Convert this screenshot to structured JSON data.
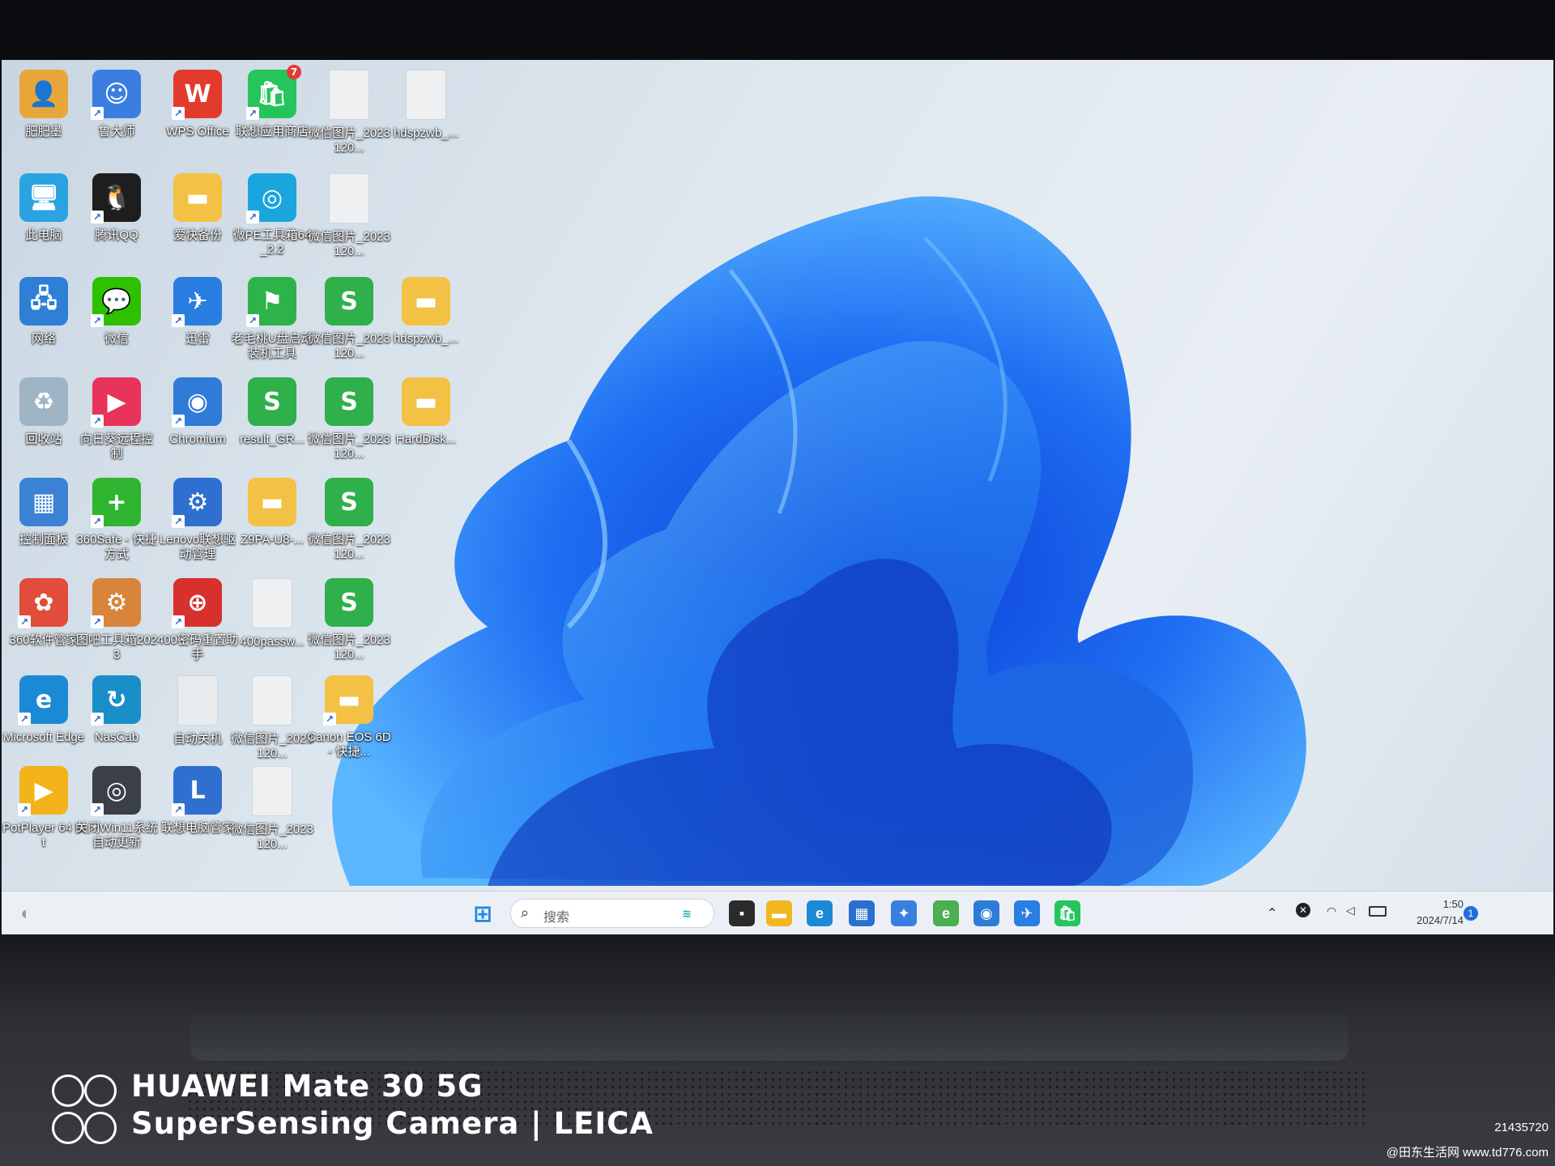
{
  "desktop_icons": [
    {
      "label": "肥肥墨",
      "color": "#e8a63a",
      "glyph": "👤",
      "shortcut": false
    },
    {
      "label": "此电脑",
      "color": "#2aa3e0",
      "glyph": "🖥",
      "shortcut": false
    },
    {
      "label": "网络",
      "color": "#2f7fd6",
      "glyph": "🖧",
      "shortcut": false
    },
    {
      "label": "回收站",
      "color": "#9fb4c4",
      "glyph": "♻",
      "shortcut": false
    },
    {
      "label": "控制面板",
      "color": "#3b82d4",
      "glyph": "▦",
      "shortcut": false
    },
    {
      "label": "360软件管家",
      "color": "#e14c3b",
      "glyph": "✿",
      "shortcut": true
    },
    {
      "label": "Microsoft Edge",
      "color": "#1b8ad6",
      "glyph": "e",
      "shortcut": true
    },
    {
      "label": "PotPlayer 64 bit",
      "color": "#f2b31b",
      "glyph": "▶",
      "shortcut": true
    },
    {
      "label": "鲁大师",
      "color": "#3a7fe0",
      "glyph": "☺",
      "shortcut": true
    },
    {
      "label": "腾讯QQ",
      "color": "#1e1e1e",
      "glyph": "🐧",
      "shortcut": true
    },
    {
      "label": "微信",
      "color": "#2dc100",
      "glyph": "💬",
      "shortcut": true
    },
    {
      "label": "向日葵远程控制",
      "color": "#e8345a",
      "glyph": "▶",
      "shortcut": true
    },
    {
      "label": "360Safe - 快捷方式",
      "color": "#2fb52f",
      "glyph": "+",
      "shortcut": true
    },
    {
      "label": "图吧工具箱2023",
      "color": "#d8843b",
      "glyph": "⚙",
      "shortcut": true
    },
    {
      "label": "NasCab",
      "color": "#1a8ec8",
      "glyph": "↻",
      "shortcut": true
    },
    {
      "label": "关闭Win11系统自动更新",
      "color": "#3a3f48",
      "glyph": "◎",
      "shortcut": true
    },
    {
      "label": "WPS Office",
      "color": "#e23b2e",
      "glyph": "W",
      "shortcut": true
    },
    {
      "label": "爱快备份",
      "color": "#f3c244",
      "glyph": "▬",
      "shortcut": false
    },
    {
      "label": "迅雷",
      "color": "#2a7de1",
      "glyph": "✈",
      "shortcut": true
    },
    {
      "label": "Chromium",
      "color": "#2e7bd8",
      "glyph": "◉",
      "shortcut": true
    },
    {
      "label": "Lenovo联想驱动管理",
      "color": "#2f6fd0",
      "glyph": "⚙",
      "shortcut": true
    },
    {
      "label": "400密码重置助手",
      "color": "#d8302c",
      "glyph": "⊕",
      "shortcut": true
    },
    {
      "label": "自动关机",
      "color": "#e9ecef",
      "glyph": "",
      "shortcut": false
    },
    {
      "label": "联想电脑管家",
      "color": "#2f6fd0",
      "glyph": "L",
      "shortcut": true
    },
    {
      "label": "联想应用商店",
      "color": "#25c45c",
      "glyph": "🛍",
      "shortcut": true
    },
    {
      "label": "微PE工具箱64_2.2",
      "color": "#1aa6dc",
      "glyph": "◎",
      "shortcut": true
    },
    {
      "label": "老毛桃U盘启动装机工具",
      "color": "#2db34a",
      "glyph": "⚑",
      "shortcut": true
    },
    {
      "label": "result_GR...",
      "color": "#2fb04a",
      "glyph": "S",
      "shortcut": false
    },
    {
      "label": "Z9PA-U8-...",
      "color": "#f3c244",
      "glyph": "▬",
      "shortcut": false
    },
    {
      "label": "400passw...",
      "color": "#eef0f2",
      "glyph": "",
      "shortcut": false
    },
    {
      "label": "微信图片_2023120...",
      "color": "#eef0f2",
      "glyph": "",
      "shortcut": false
    },
    {
      "label": "微信图片_2023120...",
      "color": "#eef0f2",
      "glyph": "",
      "shortcut": false
    },
    {
      "label": "微信图片_2023120...",
      "color": "#eef0f2",
      "glyph": "",
      "shortcut": false
    },
    {
      "label": "微信图片_2023120...",
      "color": "#eef0f2",
      "glyph": "",
      "shortcut": false
    },
    {
      "label": "微信图片_2023120...",
      "color": "#2fb04a",
      "glyph": "S",
      "shortcut": false
    },
    {
      "label": "微信图片_2023120...",
      "color": "#2fb04a",
      "glyph": "S",
      "shortcut": false
    },
    {
      "label": "微信图片_2023120...",
      "color": "#2fb04a",
      "glyph": "S",
      "shortcut": false
    },
    {
      "label": "微信图片_2023120...",
      "color": "#2fb04a",
      "glyph": "S",
      "shortcut": false
    },
    {
      "label": "Canon EOS 6D - 快捷...",
      "color": "#f3c244",
      "glyph": "▬",
      "shortcut": true
    },
    {
      "label": "hdspzwb_...",
      "color": "#eef0f2",
      "glyph": "",
      "shortcut": false
    },
    {
      "label": "hdspzwb_...",
      "color": "#f3c244",
      "glyph": "▬",
      "shortcut": false
    },
    {
      "label": "HardDisk...",
      "color": "#f3c244",
      "glyph": "▬",
      "shortcut": false
    }
  ],
  "store_badge": "7",
  "taskbar": {
    "search_placeholder": "搜索",
    "pinned": [
      {
        "name": "windows-start-icon",
        "color": "#1e88e5",
        "glyph": "⊞"
      },
      {
        "name": "task-view-icon",
        "color": "#2b2b2b",
        "glyph": "▪"
      },
      {
        "name": "file-explorer-icon",
        "color": "#f2b720",
        "glyph": "▬"
      },
      {
        "name": "edge-icon",
        "color": "#1b8ad6",
        "glyph": "e"
      },
      {
        "name": "store-icon",
        "color": "#2a6fd0",
        "glyph": "▦"
      },
      {
        "name": "app-icon",
        "color": "#3a7fe0",
        "glyph": "✦"
      },
      {
        "name": "ie-icon",
        "color": "#4caf50",
        "glyph": "e"
      },
      {
        "name": "chromium-icon",
        "color": "#2e7bd8",
        "glyph": "◉"
      },
      {
        "name": "thunder-icon",
        "color": "#2a7de1",
        "glyph": "✈"
      },
      {
        "name": "lenovo-store-icon",
        "color": "#25c45c",
        "glyph": "🛍"
      }
    ],
    "time": "1:50",
    "date": "2024/7/14"
  },
  "photo_watermark": {
    "line1": "HUAWEI Mate 30 5G",
    "line2": "SuperSensing Camera | LEICA",
    "serial": "21435720",
    "site": "@田东生活网 www.td776.com"
  }
}
